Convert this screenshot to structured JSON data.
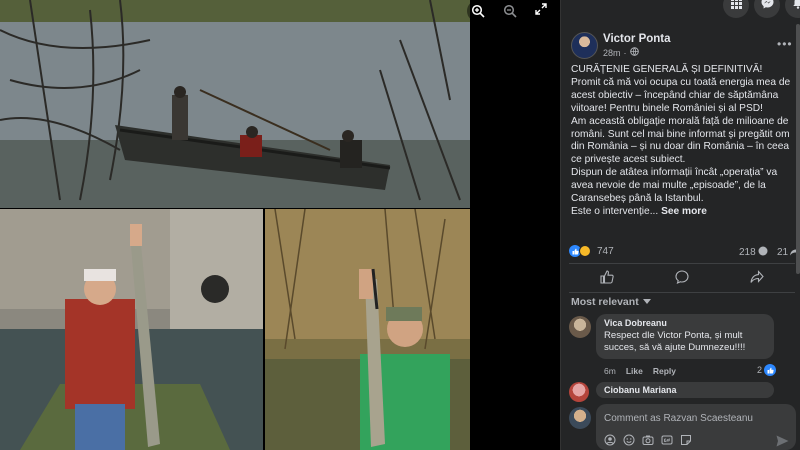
{
  "viewer": {
    "zoom_in_icon": "zoom-in-icon",
    "zoom_out_icon": "zoom-out-icon",
    "expand_icon": "expand-icon",
    "photos": [
      "boat-fishing-photo",
      "man-holding-pike-boat-photo",
      "man-holding-pike-shore-photo"
    ]
  },
  "topbar": {
    "menu_icon": "grid-menu-icon",
    "messenger_icon": "messenger-icon",
    "notifications_icon": "bell-icon"
  },
  "post": {
    "author": "Victor Ponta",
    "time": "28m",
    "privacy_icon": "globe-icon",
    "body": [
      "CURĂȚENIE GENERALĂ ȘI DEFINITIVĂ!",
      "Promit că mă voi ocupa cu toată energia mea de acest obiectiv – începând chiar de săptămâna viitoare! Pentru binele României și al PSD!",
      "Am această obligație morală față de milioane de români. Sunt cel mai bine informat și pregătit om din România – și nu doar din România – în ceea ce privește acest subiect.",
      "Dispun de atâtea informații încât „operația” va avea nevoie de mai multe „episoade”, de la Caransebeș până la Istanbul.",
      "Este o intervenție..."
    ],
    "see_more": "See more",
    "reaction_count": "747",
    "comment_count": "218",
    "share_count": "21",
    "actions": [
      "Like",
      "Comment",
      "Share"
    ]
  },
  "comments_filter": "Most relevant",
  "comments": [
    {
      "author": "Vica Dobreanu",
      "text": "Respect dle Victor Ponta, și mult succes, să vă ajute Dumnezeu!!!!",
      "time": "6m",
      "like_label": "Like",
      "reply_label": "Reply",
      "likes": "2"
    },
    {
      "author": "Ciobanu Mariana"
    }
  ],
  "compose": {
    "placeholder": "Comment as Razvan Scaesteanu"
  },
  "colors": {
    "panel_bg": "#242526",
    "bubble_bg": "#3a3b3c",
    "text": "#e4e6eb",
    "muted": "#b0b3b8",
    "like_blue": "#2d88ff"
  }
}
